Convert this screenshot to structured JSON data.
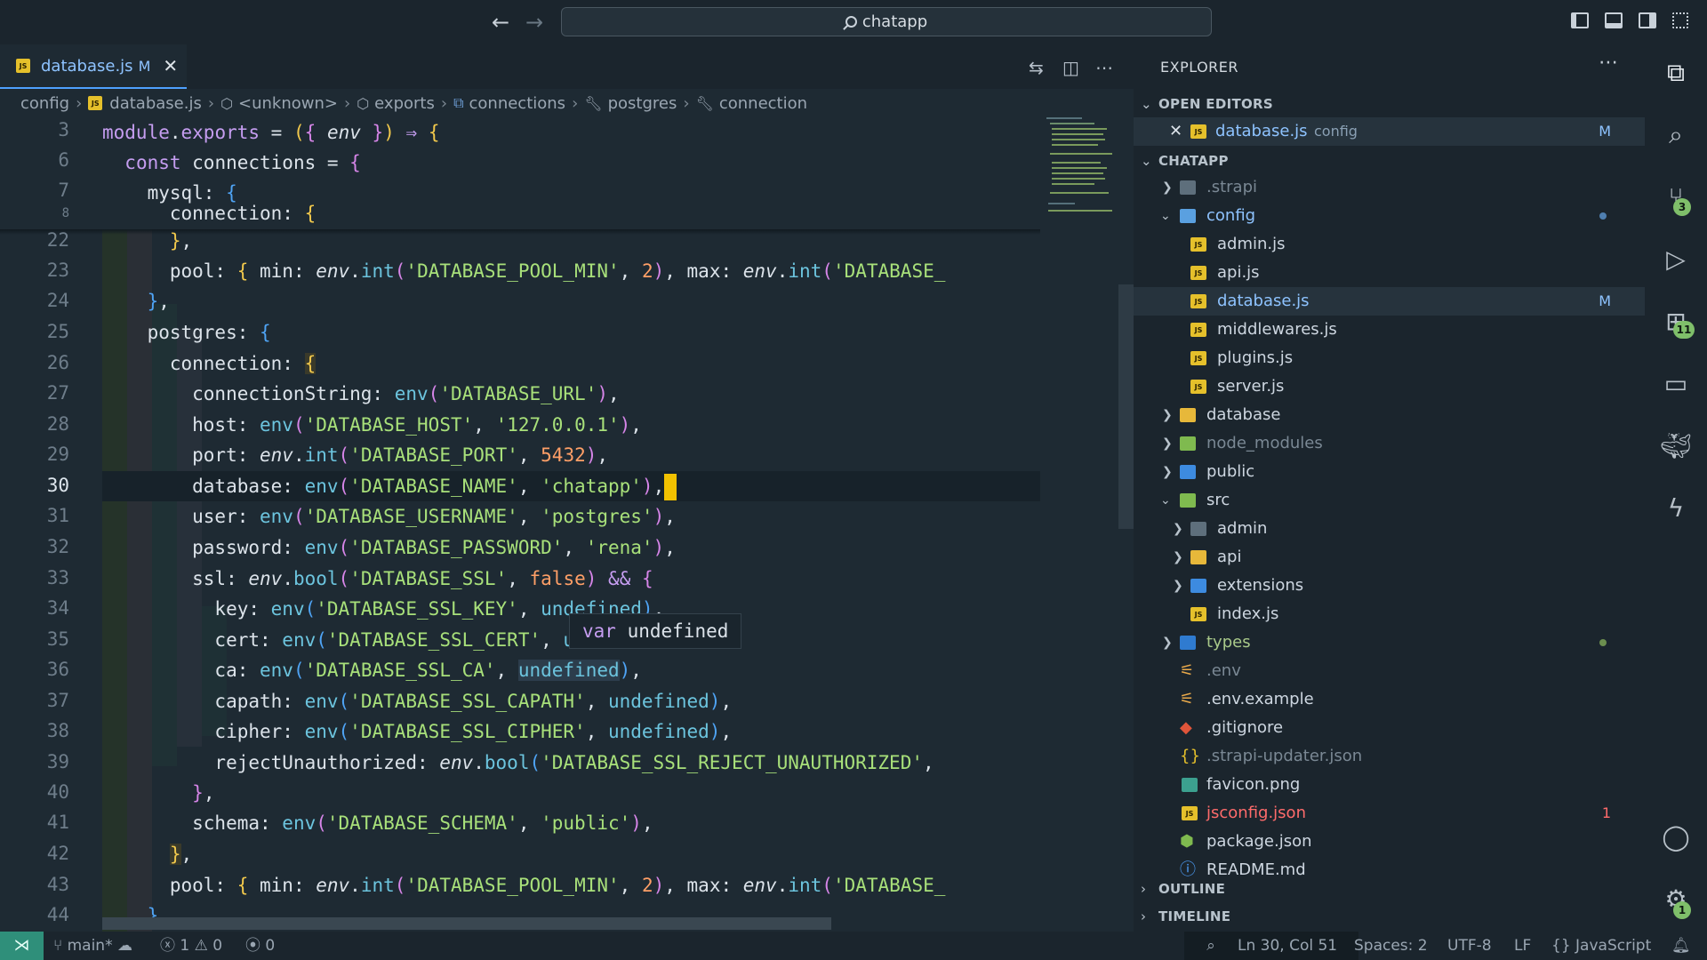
{
  "title_bar": {
    "search_text": "chatapp"
  },
  "editor": {
    "tab": {
      "name": "database.js",
      "status": "M"
    },
    "breadcrumb": [
      "config",
      "database.js",
      "<unknown>",
      "exports",
      "connections",
      "postgres",
      "connection"
    ],
    "sticky_line_numbers": [
      "3",
      "6",
      "7",
      "8"
    ],
    "line_numbers": [
      "22",
      "23",
      "24",
      "25",
      "26",
      "27",
      "28",
      "29",
      "30",
      "31",
      "32",
      "33",
      "34",
      "35",
      "36",
      "37",
      "38",
      "39",
      "40",
      "41",
      "42",
      "43",
      "44"
    ],
    "active_line": "30",
    "hover": {
      "keyword": "var",
      "text": "undefined"
    }
  },
  "explorer": {
    "title": "EXPLORER",
    "open_editors_label": "OPEN EDITORS",
    "open_editor": {
      "name": "database.js",
      "folder": "config",
      "status": "M"
    },
    "project_label": "CHATAPP",
    "items": [
      {
        "label": ".strapi"
      },
      {
        "label": "config"
      },
      {
        "label": "admin.js"
      },
      {
        "label": "api.js"
      },
      {
        "label": "database.js",
        "status": "M"
      },
      {
        "label": "middlewares.js"
      },
      {
        "label": "plugins.js"
      },
      {
        "label": "server.js"
      },
      {
        "label": "database"
      },
      {
        "label": "node_modules"
      },
      {
        "label": "public"
      },
      {
        "label": "src"
      },
      {
        "label": "admin"
      },
      {
        "label": "api"
      },
      {
        "label": "extensions"
      },
      {
        "label": "index.js"
      },
      {
        "label": "types"
      },
      {
        "label": ".env"
      },
      {
        "label": ".env.example"
      },
      {
        "label": ".gitignore"
      },
      {
        "label": ".strapi-updater.json"
      },
      {
        "label": "favicon.png"
      },
      {
        "label": "jsconfig.json",
        "problems": "1"
      },
      {
        "label": "package.json"
      },
      {
        "label": "README.md"
      }
    ],
    "outline_label": "OUTLINE",
    "timeline_label": "TIMELINE"
  },
  "activity_bar": {
    "source_control_badge": "3",
    "extensions_badge": "11",
    "settings_badge": "1"
  },
  "status_bar": {
    "branch": "main*",
    "errors": "1",
    "warnings": "0",
    "ports": "0",
    "cursor_position": "Ln 30, Col 51",
    "indentation": "Spaces: 2",
    "encoding": "UTF-8",
    "eol": "LF",
    "language": "JavaScript"
  },
  "colors": {
    "accent": "#4ea1ff",
    "modified": "#8ec3ff",
    "cursor": "#f2c100",
    "remote": "#2f8f7a",
    "error": "#ff6b6b"
  }
}
